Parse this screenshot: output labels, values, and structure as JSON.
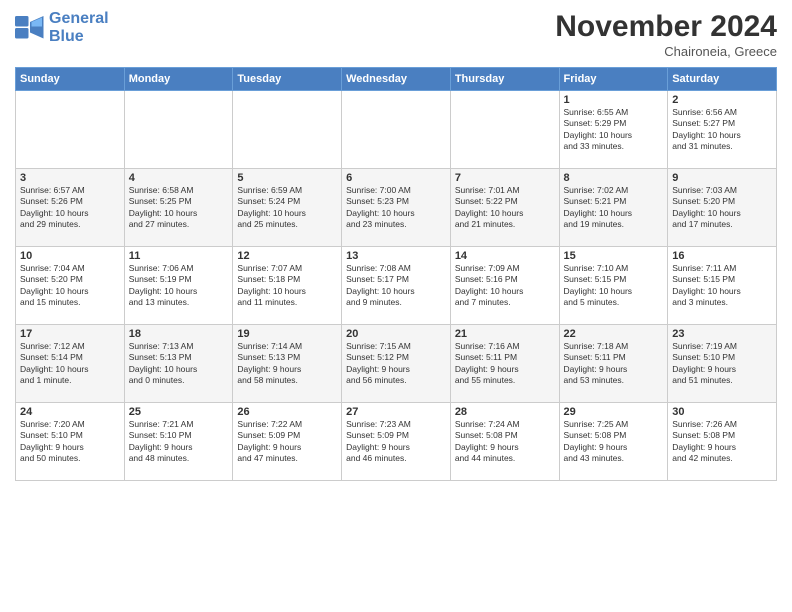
{
  "header": {
    "logo_line1": "General",
    "logo_line2": "Blue",
    "month": "November 2024",
    "location": "Chaironeia, Greece"
  },
  "days_of_week": [
    "Sunday",
    "Monday",
    "Tuesday",
    "Wednesday",
    "Thursday",
    "Friday",
    "Saturday"
  ],
  "weeks": [
    [
      {
        "num": "",
        "info": ""
      },
      {
        "num": "",
        "info": ""
      },
      {
        "num": "",
        "info": ""
      },
      {
        "num": "",
        "info": ""
      },
      {
        "num": "",
        "info": ""
      },
      {
        "num": "1",
        "info": "Sunrise: 6:55 AM\nSunset: 5:29 PM\nDaylight: 10 hours\nand 33 minutes."
      },
      {
        "num": "2",
        "info": "Sunrise: 6:56 AM\nSunset: 5:27 PM\nDaylight: 10 hours\nand 31 minutes."
      }
    ],
    [
      {
        "num": "3",
        "info": "Sunrise: 6:57 AM\nSunset: 5:26 PM\nDaylight: 10 hours\nand 29 minutes."
      },
      {
        "num": "4",
        "info": "Sunrise: 6:58 AM\nSunset: 5:25 PM\nDaylight: 10 hours\nand 27 minutes."
      },
      {
        "num": "5",
        "info": "Sunrise: 6:59 AM\nSunset: 5:24 PM\nDaylight: 10 hours\nand 25 minutes."
      },
      {
        "num": "6",
        "info": "Sunrise: 7:00 AM\nSunset: 5:23 PM\nDaylight: 10 hours\nand 23 minutes."
      },
      {
        "num": "7",
        "info": "Sunrise: 7:01 AM\nSunset: 5:22 PM\nDaylight: 10 hours\nand 21 minutes."
      },
      {
        "num": "8",
        "info": "Sunrise: 7:02 AM\nSunset: 5:21 PM\nDaylight: 10 hours\nand 19 minutes."
      },
      {
        "num": "9",
        "info": "Sunrise: 7:03 AM\nSunset: 5:20 PM\nDaylight: 10 hours\nand 17 minutes."
      }
    ],
    [
      {
        "num": "10",
        "info": "Sunrise: 7:04 AM\nSunset: 5:20 PM\nDaylight: 10 hours\nand 15 minutes."
      },
      {
        "num": "11",
        "info": "Sunrise: 7:06 AM\nSunset: 5:19 PM\nDaylight: 10 hours\nand 13 minutes."
      },
      {
        "num": "12",
        "info": "Sunrise: 7:07 AM\nSunset: 5:18 PM\nDaylight: 10 hours\nand 11 minutes."
      },
      {
        "num": "13",
        "info": "Sunrise: 7:08 AM\nSunset: 5:17 PM\nDaylight: 10 hours\nand 9 minutes."
      },
      {
        "num": "14",
        "info": "Sunrise: 7:09 AM\nSunset: 5:16 PM\nDaylight: 10 hours\nand 7 minutes."
      },
      {
        "num": "15",
        "info": "Sunrise: 7:10 AM\nSunset: 5:15 PM\nDaylight: 10 hours\nand 5 minutes."
      },
      {
        "num": "16",
        "info": "Sunrise: 7:11 AM\nSunset: 5:15 PM\nDaylight: 10 hours\nand 3 minutes."
      }
    ],
    [
      {
        "num": "17",
        "info": "Sunrise: 7:12 AM\nSunset: 5:14 PM\nDaylight: 10 hours\nand 1 minute."
      },
      {
        "num": "18",
        "info": "Sunrise: 7:13 AM\nSunset: 5:13 PM\nDaylight: 10 hours\nand 0 minutes."
      },
      {
        "num": "19",
        "info": "Sunrise: 7:14 AM\nSunset: 5:13 PM\nDaylight: 9 hours\nand 58 minutes."
      },
      {
        "num": "20",
        "info": "Sunrise: 7:15 AM\nSunset: 5:12 PM\nDaylight: 9 hours\nand 56 minutes."
      },
      {
        "num": "21",
        "info": "Sunrise: 7:16 AM\nSunset: 5:11 PM\nDaylight: 9 hours\nand 55 minutes."
      },
      {
        "num": "22",
        "info": "Sunrise: 7:18 AM\nSunset: 5:11 PM\nDaylight: 9 hours\nand 53 minutes."
      },
      {
        "num": "23",
        "info": "Sunrise: 7:19 AM\nSunset: 5:10 PM\nDaylight: 9 hours\nand 51 minutes."
      }
    ],
    [
      {
        "num": "24",
        "info": "Sunrise: 7:20 AM\nSunset: 5:10 PM\nDaylight: 9 hours\nand 50 minutes."
      },
      {
        "num": "25",
        "info": "Sunrise: 7:21 AM\nSunset: 5:10 PM\nDaylight: 9 hours\nand 48 minutes."
      },
      {
        "num": "26",
        "info": "Sunrise: 7:22 AM\nSunset: 5:09 PM\nDaylight: 9 hours\nand 47 minutes."
      },
      {
        "num": "27",
        "info": "Sunrise: 7:23 AM\nSunset: 5:09 PM\nDaylight: 9 hours\nand 46 minutes."
      },
      {
        "num": "28",
        "info": "Sunrise: 7:24 AM\nSunset: 5:08 PM\nDaylight: 9 hours\nand 44 minutes."
      },
      {
        "num": "29",
        "info": "Sunrise: 7:25 AM\nSunset: 5:08 PM\nDaylight: 9 hours\nand 43 minutes."
      },
      {
        "num": "30",
        "info": "Sunrise: 7:26 AM\nSunset: 5:08 PM\nDaylight: 9 hours\nand 42 minutes."
      }
    ]
  ]
}
